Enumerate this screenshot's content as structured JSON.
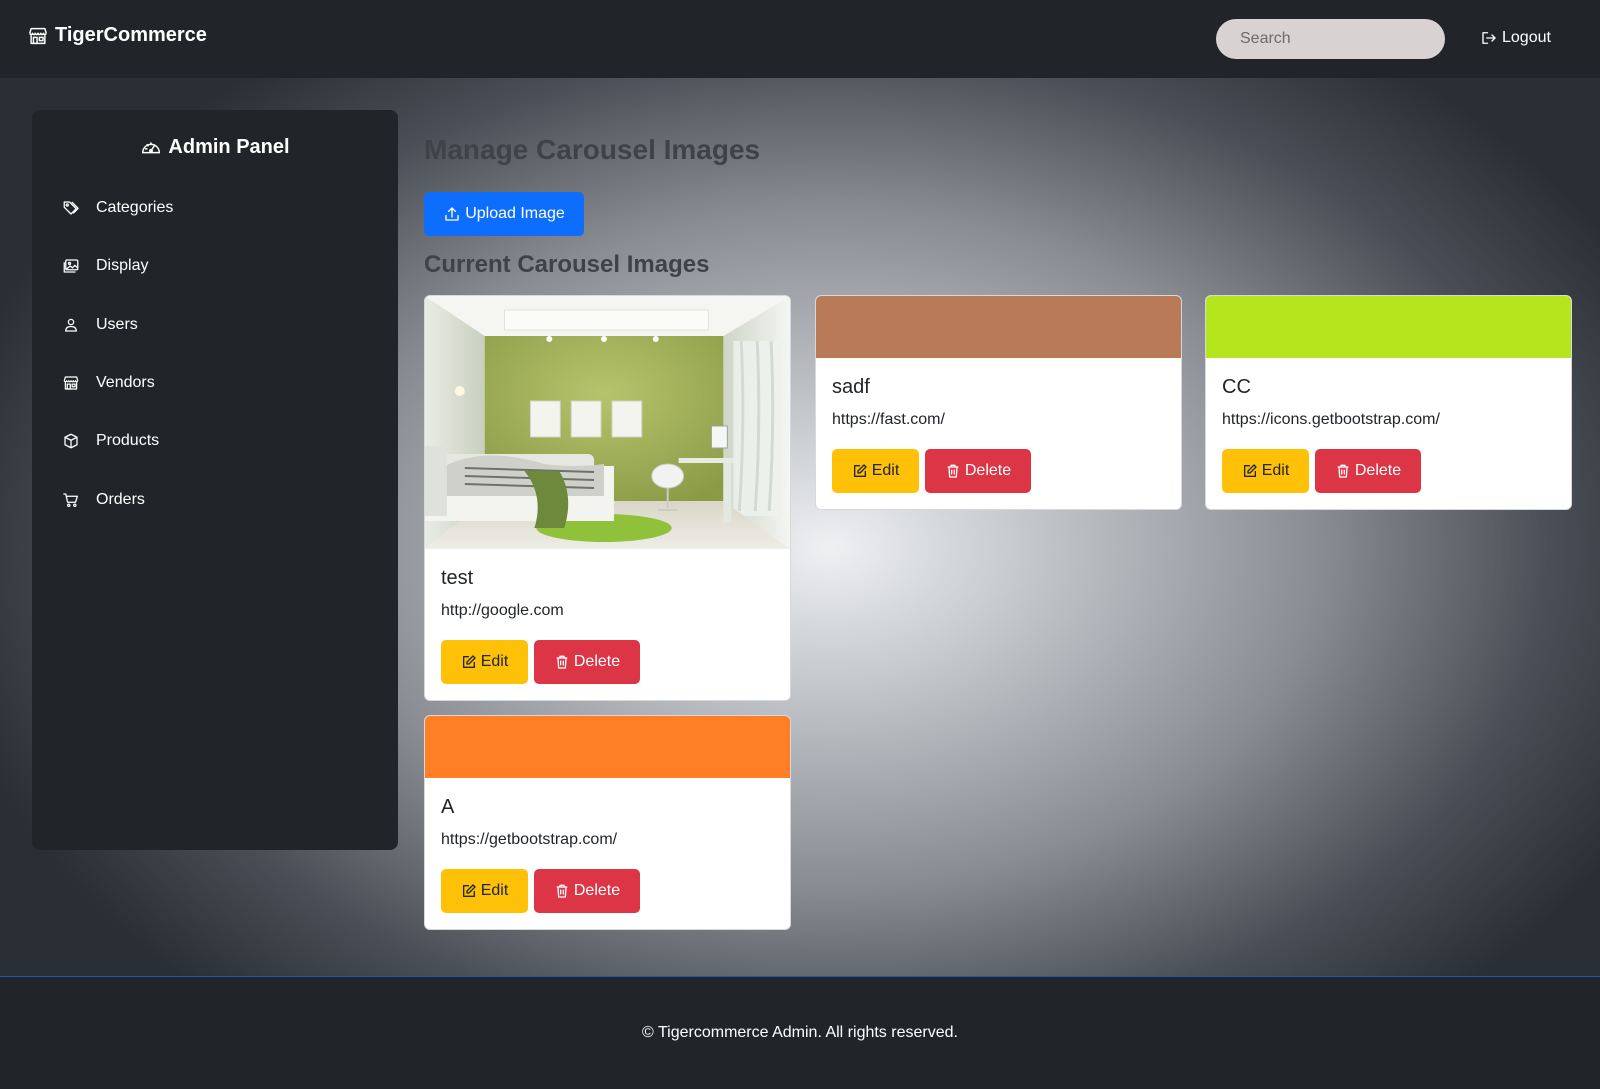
{
  "navbar": {
    "brand": "TigerCommerce",
    "brand_icon": "shop-icon",
    "search_placeholder": "Search",
    "search_value": "",
    "logout_label": "Logout",
    "logout_icon": "box-arrow-right-icon"
  },
  "sidebar": {
    "title": "Admin Panel",
    "title_icon": "speedometer-icon",
    "items": [
      {
        "label": "Categories",
        "icon": "tags-icon"
      },
      {
        "label": "Display",
        "icon": "images-icon"
      },
      {
        "label": "Users",
        "icon": "person-icon"
      },
      {
        "label": "Vendors",
        "icon": "shop-icon"
      },
      {
        "label": "Products",
        "icon": "box-icon"
      },
      {
        "label": "Orders",
        "icon": "cart-icon"
      }
    ]
  },
  "main": {
    "title": "Manage Carousel Images",
    "upload_label": "Upload Image",
    "upload_icon": "upload-icon",
    "subtitle": "Current Carousel Images",
    "edit_label": "Edit",
    "delete_label": "Delete",
    "cards": [
      {
        "title": "test",
        "url": "http://google.com",
        "image": "bedroom-photo"
      },
      {
        "title": "sadf",
        "url": "https://fast.com/",
        "color": "#b97a57"
      },
      {
        "title": "CC",
        "url": "https://icons.getbootstrap.com/",
        "color": "#b5e61d"
      },
      {
        "title": "A",
        "url": "https://getbootstrap.com/",
        "color": "#ff7f27"
      }
    ]
  },
  "colors": {
    "primary": "#0d6efd",
    "warning": "#ffc107",
    "danger": "#dc3545",
    "dark": "#212529"
  },
  "footer": {
    "text": "© Tigercommerce Admin. All rights reserved."
  }
}
